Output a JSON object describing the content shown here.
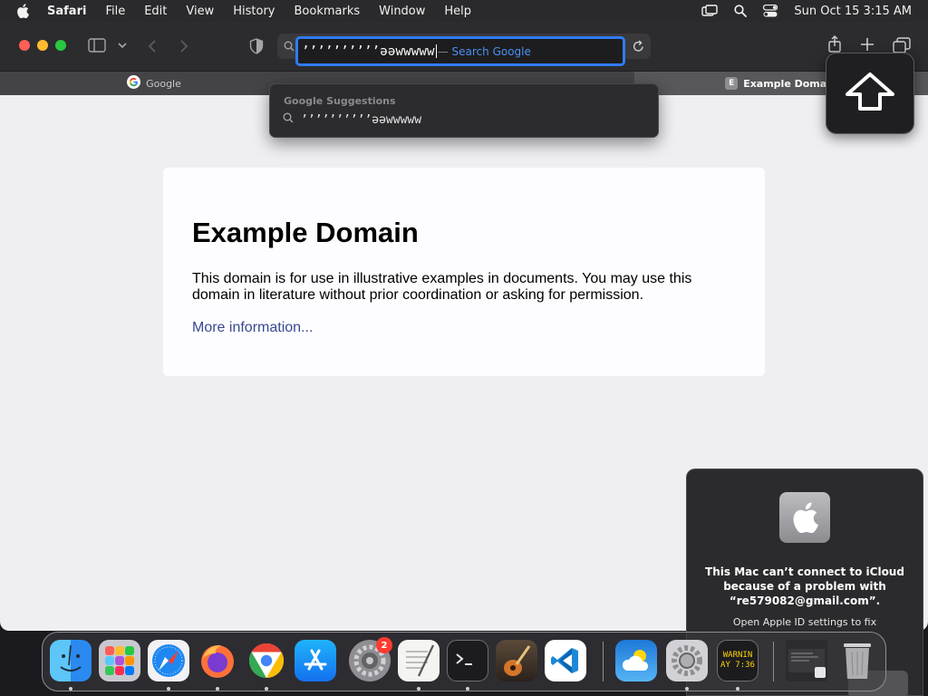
{
  "menubar": {
    "app_name": "Safari",
    "items": [
      "File",
      "Edit",
      "View",
      "History",
      "Bookmarks",
      "Window",
      "Help"
    ],
    "clock": "Sun Oct 15  3:15 AM"
  },
  "toolbar": {
    "address_value": "’’’’’’’’’’əəwwwww",
    "address_hint": "Search Google",
    "address_hint_separator": "—"
  },
  "tabs": [
    {
      "label": "Google",
      "active": false
    },
    {
      "label": "Example Domain",
      "active": true,
      "favicon_letter": "E"
    }
  ],
  "suggestions": {
    "header": "Google Suggestions",
    "items": [
      "’’’’’’’’’’əəwwwww"
    ]
  },
  "page": {
    "title": "Example Domain",
    "body": "This domain is for use in illustrative examples in documents. You may use this domain in literature without prior coordination or asking for permission.",
    "link": "More information..."
  },
  "notification": {
    "title": "This Mac can’t connect to iCloud because of a problem with “re579082@gmail.com”.",
    "action": "Open Apple ID settings to fix"
  },
  "dock": {
    "settings_badge": "2",
    "console_text": [
      "WARNIN",
      "AY 7:36"
    ]
  },
  "colors": {
    "accent": "#2f7cf6",
    "link": "#38488f",
    "badge": "#ff3b30"
  }
}
